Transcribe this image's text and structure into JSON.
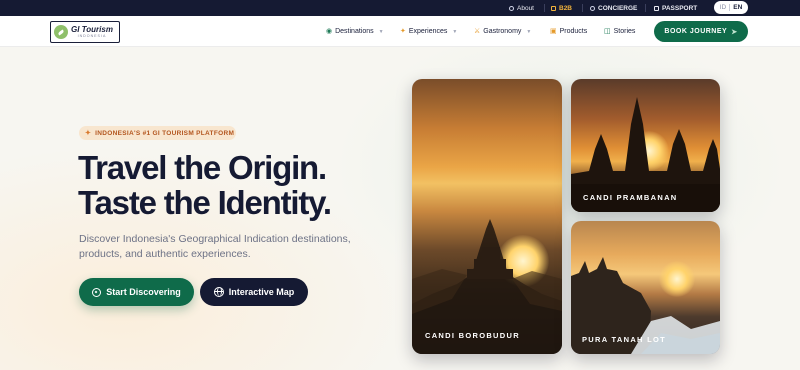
{
  "topbar": {
    "about": "About",
    "b2b": "B2B",
    "concierge": "CONCIERGE",
    "passport": "PASSPORT",
    "lang_id": "ID",
    "lang_en": "EN"
  },
  "nav": {
    "logo_title": "GI Tourism",
    "logo_sub": "INDONESIA",
    "items": [
      {
        "label": "Destinations",
        "icon": "map-pin-icon"
      },
      {
        "label": "Experiences",
        "icon": "sparkle-icon"
      },
      {
        "label": "Gastronomy",
        "icon": "utensils-icon"
      },
      {
        "label": "Products",
        "icon": "box-icon"
      },
      {
        "label": "Stories",
        "icon": "book-icon"
      }
    ],
    "book_label": "BOOK JOURNEY"
  },
  "hero": {
    "badge": "INDONESIA'S #1 GI TOURISM PLATFORM",
    "title_line1": "Travel the Origin.",
    "title_line2": "Taste the Identity.",
    "lead": "Discover Indonesia's Geographical Indication destinations, products, and authentic experiences.",
    "primary_cta": "Start Discovering",
    "secondary_cta": "Interactive Map"
  },
  "cards": [
    {
      "caption": "CANDI BOROBUDUR"
    },
    {
      "caption": "CANDI PRAMBANAN"
    },
    {
      "caption": "PURA TANAH LOT"
    }
  ],
  "colors": {
    "brand_green": "#0f6b4a",
    "navy": "#151a33",
    "accent_orange": "#b3561f"
  }
}
